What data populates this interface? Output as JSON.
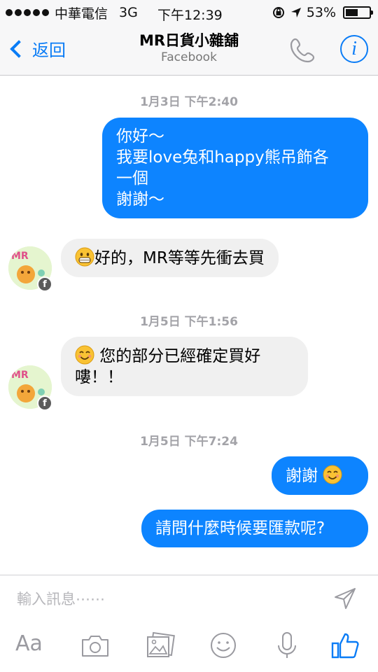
{
  "status_bar": {
    "carrier": "中華電信",
    "network": "3G",
    "time": "下午12:39",
    "battery": "53%",
    "battery_level": 0.53
  },
  "nav": {
    "back_label": "返回",
    "title": "MR日貨小雜舖",
    "subtitle": "Facebook",
    "accent_color": "#0a7cf6"
  },
  "messages": [
    {
      "type": "timestamp",
      "text": "1月3日 下午2:40"
    },
    {
      "type": "outgoing",
      "lines": [
        "你好～",
        "我要love兔和happy熊吊飾各",
        "一個",
        "謝謝～"
      ]
    },
    {
      "type": "incoming",
      "emoji": "grinning-face",
      "text": "好的，MR等等先衝去買"
    },
    {
      "type": "timestamp",
      "text": "1月5日 下午1:56"
    },
    {
      "type": "incoming",
      "emoji": "smiling-face",
      "lines": [
        " 您的部分已經確定買好",
        "嘍！！"
      ]
    },
    {
      "type": "timestamp",
      "text": "1月5日 下午7:24"
    },
    {
      "type": "outgoing",
      "text": "謝謝 ",
      "emoji": "smiling-face"
    },
    {
      "type": "outgoing",
      "text": "請問什麼時候要匯款呢?"
    }
  ],
  "composer": {
    "placeholder": "輸入訊息⋯⋯",
    "aa_label": "Aa",
    "toolbar_icons": [
      "camera-icon",
      "photo-icon",
      "emoji-icon",
      "microphone-icon",
      "like-icon"
    ]
  },
  "colors": {
    "outgoing_bubble": "#0d84ff",
    "incoming_bubble": "#f0f0f0",
    "timestamp_text": "#a3a3a8"
  }
}
